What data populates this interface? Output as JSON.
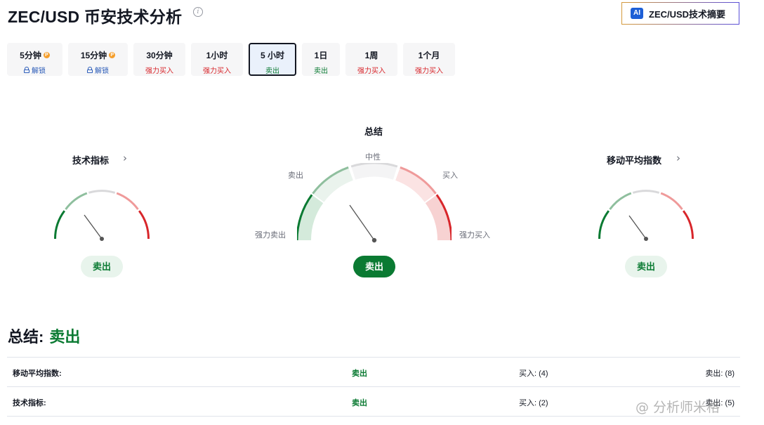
{
  "header": {
    "title": "ZEC/USD 币安技术分析",
    "ai_badge": "AI",
    "ai_button": "ZEC/USD技术摘要"
  },
  "tabs": [
    {
      "label": "5分钟",
      "status": "解锁",
      "kind": "lock",
      "pro": true
    },
    {
      "label": "15分钟",
      "status": "解锁",
      "kind": "lock",
      "pro": true
    },
    {
      "label": "30分钟",
      "status": "强力买入",
      "kind": "buy"
    },
    {
      "label": "1小时",
      "status": "强力买入",
      "kind": "buy"
    },
    {
      "label": "5 小时",
      "status": "卖出",
      "kind": "sell",
      "active": true
    },
    {
      "label": "1日",
      "status": "卖出",
      "kind": "sell"
    },
    {
      "label": "1周",
      "status": "强力买入",
      "kind": "buy"
    },
    {
      "label": "1个月",
      "status": "强力买入",
      "kind": "buy"
    }
  ],
  "gauges": {
    "left": {
      "title": "技术指标",
      "result": "卖出"
    },
    "center": {
      "title": "总结",
      "result": "卖出",
      "labels": {
        "neutral": "中性",
        "sell": "卖出",
        "buy": "买入",
        "strong_sell": "强力卖出",
        "strong_buy": "强力买入"
      }
    },
    "right": {
      "title": "移动平均指数",
      "result": "卖出"
    }
  },
  "summary": {
    "label": "总结:",
    "value": "卖出",
    "rows": [
      {
        "name": "移动平均指数:",
        "signal": "卖出",
        "buy": "买入: (4)",
        "sell": "卖出: (8)"
      },
      {
        "name": "技术指标:",
        "signal": "卖出",
        "buy": "买入: (2)",
        "sell": "卖出: (5)"
      }
    ]
  },
  "watermark": "@ 分析师米格",
  "colors": {
    "sell": "#0a7a32",
    "buy": "#d8262b",
    "neutral": "#d9d9db",
    "lock": "#2a5bb8",
    "pro": "#f59e2b"
  }
}
